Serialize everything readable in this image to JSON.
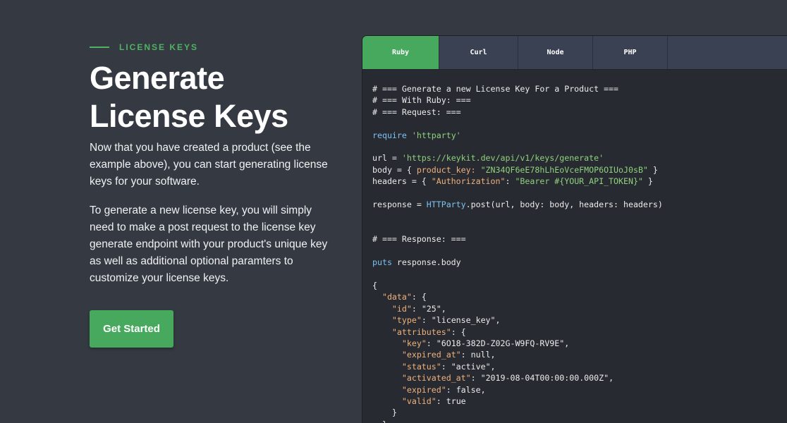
{
  "hero": {
    "eyebrow": "LICENSE KEYS",
    "headline_line1": "Generate",
    "headline_line2": "License Keys",
    "paragraph1": "Now that you have created a product (see the example above), you can start generating license keys for your software.",
    "paragraph2": "To generate a new license key, you will simply need to make a post request to the license key generate endpoint with your product's unique key as well as additional optional paramters to customize your license keys.",
    "cta_label": "Get Started"
  },
  "code_tabs": {
    "items": [
      {
        "label": "Ruby",
        "active": true
      },
      {
        "label": "Curl",
        "active": false
      },
      {
        "label": "Node",
        "active": false
      },
      {
        "label": "PHP",
        "active": false
      }
    ]
  },
  "code": {
    "comment_title": "# === Generate a new License Key For a Product ===",
    "comment_lang": "# === With Ruby: ===",
    "comment_request": "# === Request: ===",
    "require_kw": "require",
    "require_lib": "'httparty'",
    "url_prefix": "url = ",
    "url_value": "'https://keykit.dev/api/v1/keys/generate'",
    "body_prefix": "body = { ",
    "body_key": "product_key:",
    "body_value": "\"ZN34QF6eE78hLhEoVceFMOP6OIUoJ0sB\"",
    "body_suffix": " }",
    "headers_prefix": "headers = { ",
    "headers_key": "\"Authorization\"",
    "headers_value": "\"Bearer #{YOUR_API_TOKEN}\"",
    "headers_suffix": " }",
    "response_prefix": "response = ",
    "response_cls": "HTTParty",
    "response_call": ".post(url, body: body, headers: headers)",
    "comment_response": "# === Response: ===",
    "puts_kw": "puts",
    "puts_rest": " response.body",
    "json_open": "{",
    "data_key": "\"data\"",
    "id_key": "\"id\"",
    "id_val": "\"25\"",
    "type_key": "\"type\"",
    "type_val": "\"license_key\"",
    "attributes_key": "\"attributes\"",
    "key_key": "\"key\"",
    "key_val": "\"6O18-382D-Z02G-W9FQ-RV9E\"",
    "expired_at_key": "\"expired_at\"",
    "expired_at_val": "null",
    "status_key": "\"status\"",
    "status_val": "\"active\"",
    "activated_at_key": "\"activated_at\"",
    "activated_at_val": "\"2019-08-04T00:00:00.000Z\"",
    "expired_key": "\"expired\"",
    "expired_val": "false",
    "valid_key": "\"valid\"",
    "valid_val": "true",
    "close_attr": "}",
    "close_data": "}"
  },
  "colors": {
    "background": "#353a42",
    "accent_green": "#47a95d",
    "code_bg": "#272a30",
    "tab_bg": "#3a4152"
  }
}
